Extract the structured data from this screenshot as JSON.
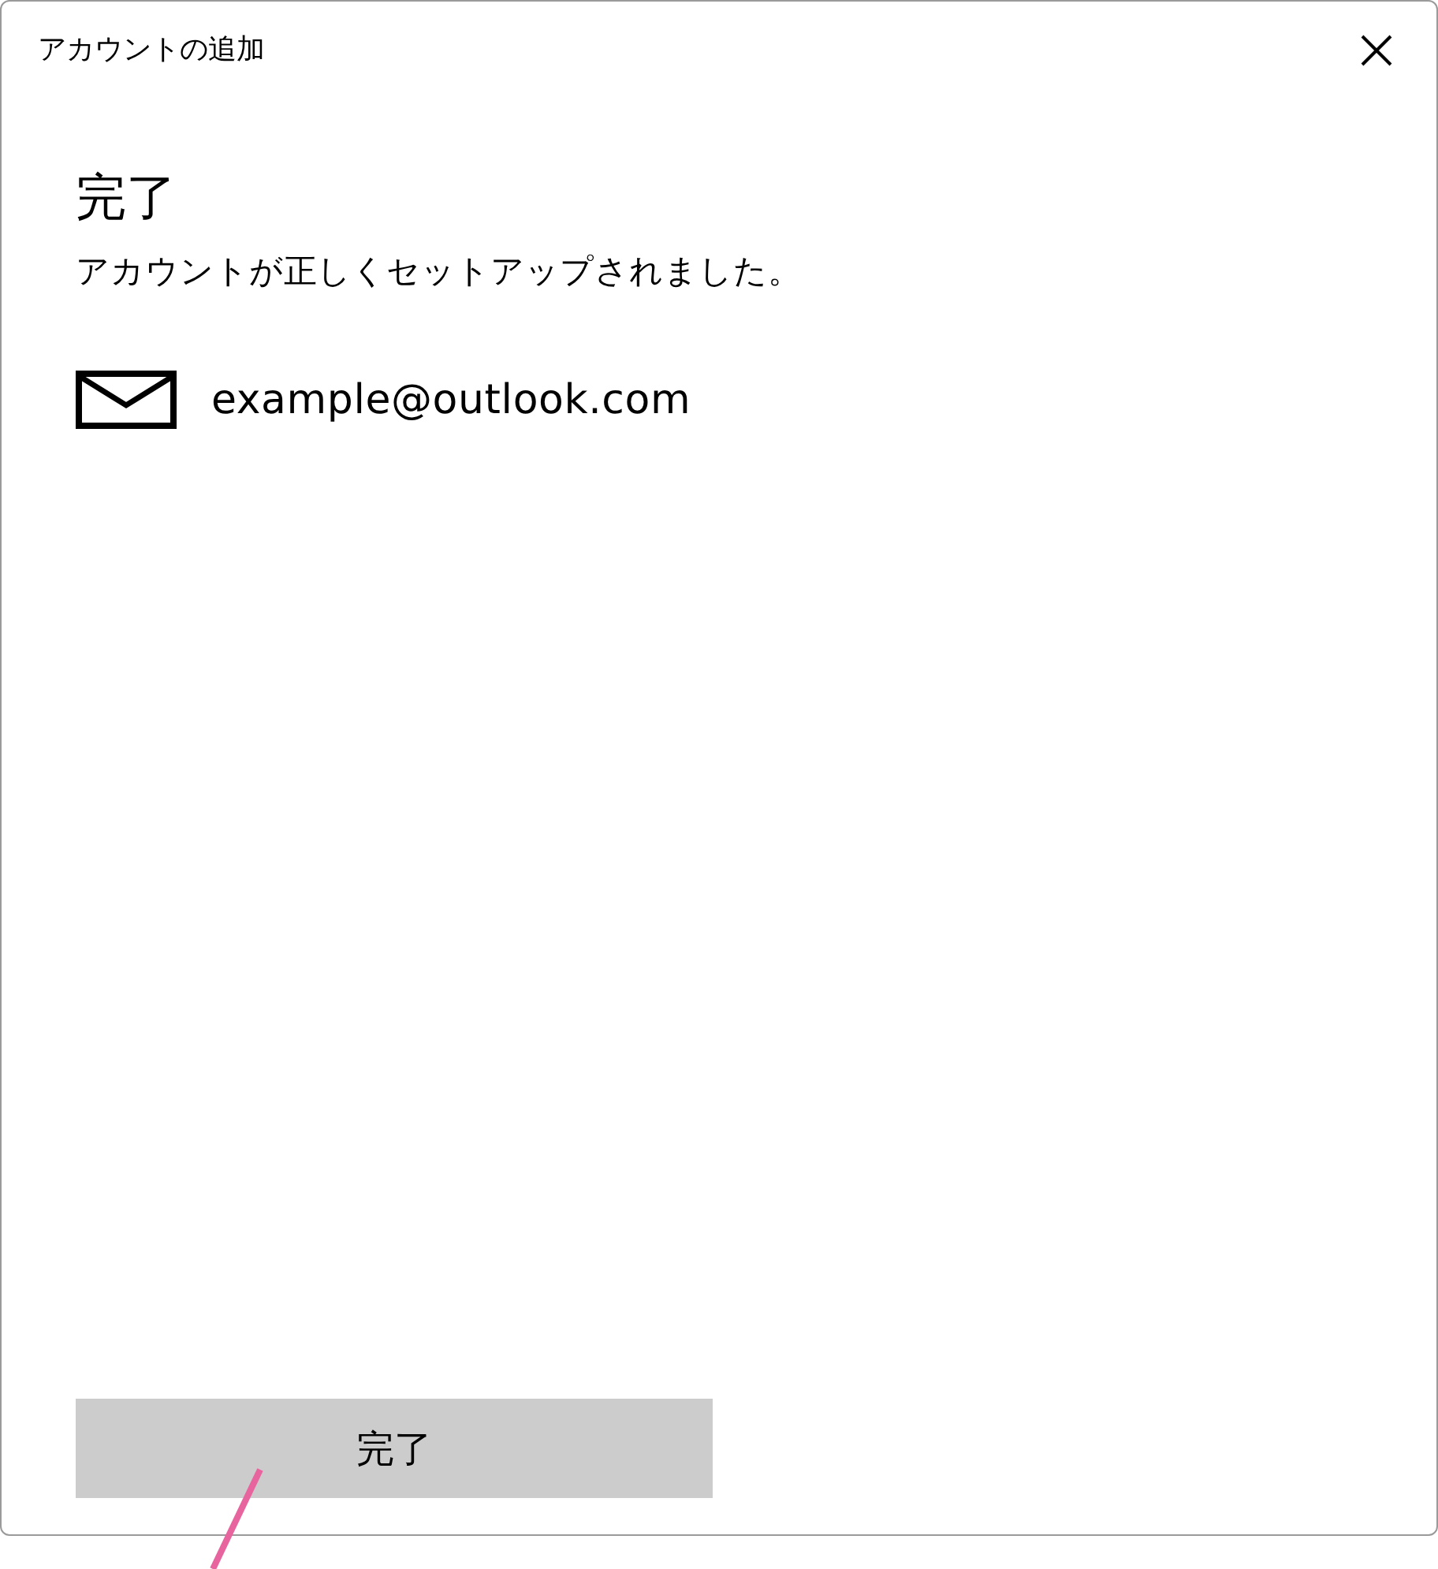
{
  "window": {
    "title": "アカウントの追加"
  },
  "content": {
    "heading": "完了",
    "message": "アカウントが正しくセットアップされました。"
  },
  "account": {
    "email": "example@outlook.com"
  },
  "buttons": [
    {
      "label": "完了"
    }
  ]
}
